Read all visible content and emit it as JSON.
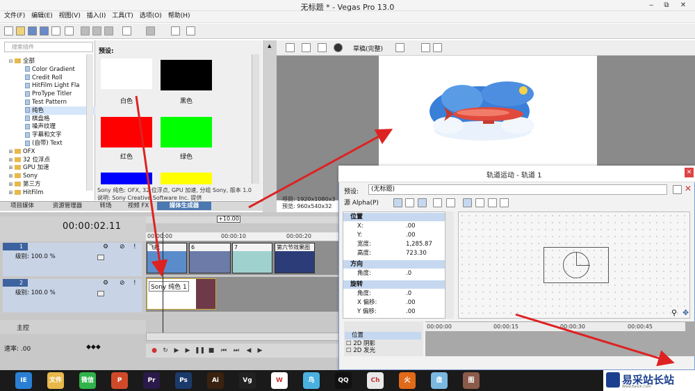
{
  "window": {
    "title": "无标题 * - Vegas Pro 13.0",
    "min": "‒",
    "max": "⧉",
    "close": "✕"
  },
  "menu": [
    "文件(F)",
    "编辑(E)",
    "视图(V)",
    "插入(I)",
    "工具(T)",
    "选项(O)",
    "帮助(H)"
  ],
  "plugins": {
    "search_placeholder": "搜索插件",
    "tree": [
      {
        "label": "全部",
        "kind": "folder",
        "expand": "⊟",
        "indent": 0
      },
      {
        "label": "Color Gradient",
        "kind": "fx",
        "indent": 2
      },
      {
        "label": "Credit Roll",
        "kind": "fx",
        "indent": 2
      },
      {
        "label": "HitFilm Light Fla",
        "kind": "fx",
        "indent": 2
      },
      {
        "label": "ProType Titler",
        "kind": "fx",
        "indent": 2
      },
      {
        "label": "Test Pattern",
        "kind": "fx",
        "indent": 2
      },
      {
        "label": "纯色",
        "kind": "fx",
        "indent": 2,
        "selected": true
      },
      {
        "label": "棋盘格",
        "kind": "fx",
        "indent": 2
      },
      {
        "label": "噪声纹理",
        "kind": "fx",
        "indent": 2
      },
      {
        "label": "字幕和文字",
        "kind": "fx",
        "indent": 2
      },
      {
        "label": "(自带) Text",
        "kind": "fx",
        "indent": 2
      },
      {
        "label": "OFX",
        "kind": "folder",
        "expand": "⊞",
        "indent": 0
      },
      {
        "label": "32 位浮点",
        "kind": "folder",
        "expand": "⊞",
        "indent": 0
      },
      {
        "label": "GPU 加速",
        "kind": "folder",
        "expand": "⊞",
        "indent": 0
      },
      {
        "label": "Sony",
        "kind": "folder",
        "expand": "⊞",
        "indent": 0
      },
      {
        "label": "第三方",
        "kind": "folder",
        "expand": "⊞",
        "indent": 0
      },
      {
        "label": "HitFilm",
        "kind": "folder",
        "expand": "⊞",
        "indent": 0
      }
    ]
  },
  "presets": {
    "label": "预设:",
    "items": [
      {
        "name": "白色",
        "color": "#ffffff"
      },
      {
        "name": "黑色",
        "color": "#000000"
      },
      {
        "name": "红色",
        "color": "#ff0000"
      },
      {
        "name": "绿色",
        "color": "#00ff00"
      },
      {
        "name": "",
        "color": "#0000ff"
      },
      {
        "name": "",
        "color": "#ffff00"
      }
    ],
    "desc1": "Sony 纯色: OFX, 32 位浮点, GPU 加速, 分组 Sony, 版本 1.0",
    "desc2": "说明: Sony Creative Software Inc. 提供"
  },
  "dock_tabs": [
    "项目媒体",
    "资源管理器",
    "转场",
    "视频 FX",
    "媒体生成器"
  ],
  "preview": {
    "quality": "草稿(完整)",
    "info1": "项目: 1920x1080x3",
    "info2": "预览: 960x540x32"
  },
  "timeline": {
    "timecode": "00:00:02.11",
    "loop_len": "+10.00",
    "ruler": [
      "00:00:00",
      "00:00:10",
      "00:00:20"
    ],
    "tracks": [
      {
        "num": "1",
        "level": "级别: 100.0 %"
      },
      {
        "num": "2",
        "level": "级别: 100.0 %"
      }
    ],
    "clips": [
      "飞艇",
      "6",
      "7",
      "第六节效果图"
    ],
    "solid_clip": "Sony 纯色 1",
    "master": "主控",
    "rate": "速率: .00"
  },
  "track_motion": {
    "title": "轨道运动 - 轨道 1",
    "preset_label": "预设:",
    "preset_value": "(无标题)",
    "source": "源 Alpha(P)",
    "groups": [
      {
        "name": "位置",
        "rows": [
          [
            "X:",
            ".00"
          ],
          [
            "Y:",
            ".00"
          ],
          [
            "宽度:",
            "1,285.87"
          ],
          [
            "高度:",
            "723.30"
          ]
        ]
      },
      {
        "name": "方向",
        "rows": [
          [
            "角度:",
            ".0"
          ]
        ]
      },
      {
        "name": "旋转",
        "rows": [
          [
            "角度:",
            ".0"
          ],
          [
            "X 偏移:",
            ".00"
          ],
          [
            "Y 偏移:",
            ".00"
          ]
        ]
      }
    ],
    "kf_rows": [
      "位置",
      "2D 阴影",
      "2D 发光"
    ],
    "kf_ruler": [
      "00:00:00",
      "00:00:15",
      "00:00:30",
      "00:00:45"
    ]
  },
  "taskbar": [
    "IE",
    "文件",
    "微信",
    "P",
    "Pr",
    "Ps",
    "Ai",
    "Vg",
    "W",
    "鸟",
    "QQ",
    "Ch",
    "火",
    "盘",
    "图"
  ],
  "watermark": {
    "text": "易采站长站",
    "sub": "Www.Easck.Com"
  },
  "colors": {
    "accent": "#3d62a0",
    "arrow": "#dd2222"
  }
}
